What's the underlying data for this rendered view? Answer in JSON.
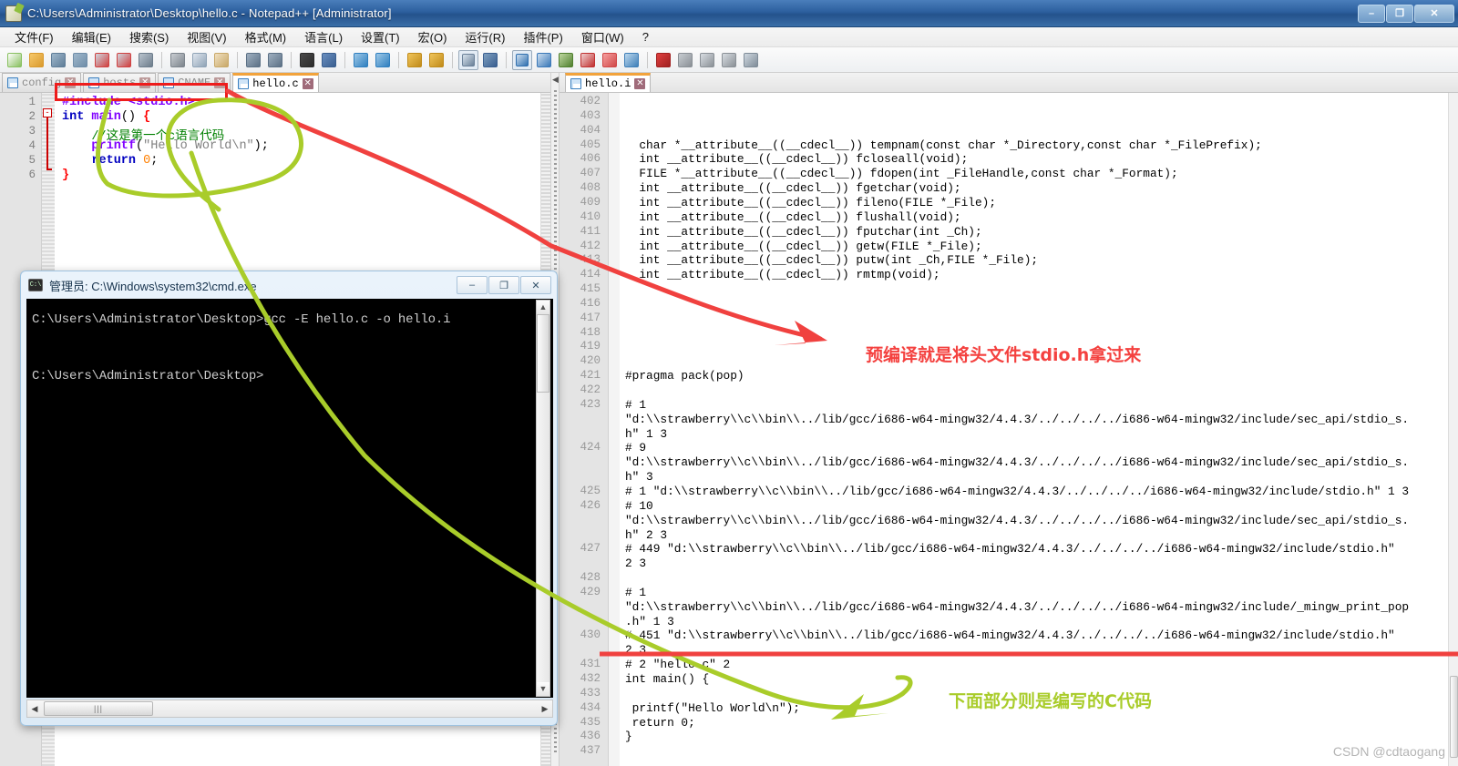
{
  "window": {
    "title": "C:\\Users\\Administrator\\Desktop\\hello.c - Notepad++ [Administrator]",
    "icon": "notepad-plus-plus-icon",
    "minimize": "–",
    "maximize": "❐",
    "close": "✕"
  },
  "menu": {
    "items": [
      "文件(F)",
      "编辑(E)",
      "搜索(S)",
      "视图(V)",
      "格式(M)",
      "语言(L)",
      "设置(T)",
      "宏(O)",
      "运行(R)",
      "插件(P)",
      "窗口(W)",
      "?"
    ]
  },
  "toolbar": {
    "groups": [
      [
        "new-file-icon",
        "open-file-icon",
        "save-icon",
        "save-all-icon",
        "close-file-icon",
        "close-all-icon",
        "print-icon"
      ],
      [
        "cut-icon",
        "copy-icon",
        "paste-icon"
      ],
      [
        "undo-icon",
        "redo-icon"
      ],
      [
        "find-icon",
        "replace-icon"
      ],
      [
        "zoom-in-icon",
        "zoom-out-icon"
      ],
      [
        "sync-scroll-v-icon",
        "sync-scroll-h-icon"
      ],
      [
        "word-wrap-icon",
        "show-all-chars-icon"
      ],
      [
        "indent-guide-icon",
        "user-defined-lang-icon",
        "show-doc-map-icon",
        "function-list-icon",
        "folder-as-workspace-icon",
        "monitor-icon"
      ],
      [
        "macro-record-icon",
        "macro-stop-icon",
        "macro-play-icon",
        "macro-run-multiple-icon",
        "macro-save-icon"
      ]
    ]
  },
  "left_pane": {
    "tabs": [
      {
        "label": "config",
        "active": false
      },
      {
        "label": "hosts",
        "active": false
      },
      {
        "label": "CNAME",
        "active": false
      },
      {
        "label": "hello.c",
        "active": true
      }
    ],
    "lines": [
      {
        "n": "1",
        "tokens": [
          {
            "t": "#include <stdio.h>",
            "c": "pre"
          }
        ]
      },
      {
        "n": "2",
        "tokens": [
          {
            "t": "int",
            "c": "kw"
          },
          {
            "t": " ",
            "c": "pln"
          },
          {
            "t": "main",
            "c": "kw2"
          },
          {
            "t": "()",
            "c": "pln"
          },
          {
            "t": " ",
            "c": "pln"
          },
          {
            "t": "{",
            "c": "brc"
          }
        ]
      },
      {
        "n": "3",
        "tokens": [
          {
            "t": "    //这是第一个c语言代码",
            "c": "cmt"
          }
        ]
      },
      {
        "n": "4",
        "tokens": [
          {
            "t": "    ",
            "c": "pln"
          },
          {
            "t": "printf",
            "c": "kw2"
          },
          {
            "t": "(",
            "c": "pln"
          },
          {
            "t": "\"Hello World\\n\"",
            "c": "str"
          },
          {
            "t": ");",
            "c": "pln"
          }
        ]
      },
      {
        "n": "5",
        "tokens": [
          {
            "t": "    ",
            "c": "pln"
          },
          {
            "t": "return",
            "c": "kw"
          },
          {
            "t": " ",
            "c": "pln"
          },
          {
            "t": "0",
            "c": "num"
          },
          {
            "t": ";",
            "c": "pln"
          }
        ]
      },
      {
        "n": "6",
        "tokens": [
          {
            "t": "}",
            "c": "brc"
          }
        ]
      }
    ]
  },
  "right_pane": {
    "tabs": [
      {
        "label": "hello.i",
        "active": true
      }
    ],
    "lines": [
      {
        "n": "402",
        "text": ""
      },
      {
        "n": "403",
        "text": ""
      },
      {
        "n": "404",
        "text": ""
      },
      {
        "n": "405",
        "text": "  char *__attribute__((__cdecl__)) tempnam(const char *_Directory,const char *_FilePrefix);"
      },
      {
        "n": "406",
        "text": "  int __attribute__((__cdecl__)) fcloseall(void);"
      },
      {
        "n": "407",
        "text": "  FILE *__attribute__((__cdecl__)) fdopen(int _FileHandle,const char *_Format);"
      },
      {
        "n": "408",
        "text": "  int __attribute__((__cdecl__)) fgetchar(void);"
      },
      {
        "n": "409",
        "text": "  int __attribute__((__cdecl__)) fileno(FILE *_File);"
      },
      {
        "n": "410",
        "text": "  int __attribute__((__cdecl__)) flushall(void);"
      },
      {
        "n": "411",
        "text": "  int __attribute__((__cdecl__)) fputchar(int _Ch);"
      },
      {
        "n": "412",
        "text": "  int __attribute__((__cdecl__)) getw(FILE *_File);"
      },
      {
        "n": "413",
        "text": "  int __attribute__((__cdecl__)) putw(int _Ch,FILE *_File);"
      },
      {
        "n": "414",
        "text": "  int __attribute__((__cdecl__)) rmtmp(void);"
      },
      {
        "n": "415",
        "text": ""
      },
      {
        "n": "416",
        "text": ""
      },
      {
        "n": "417",
        "text": ""
      },
      {
        "n": "418",
        "text": ""
      },
      {
        "n": "419",
        "text": ""
      },
      {
        "n": "420",
        "text": ""
      },
      {
        "n": "421",
        "text": "#pragma pack(pop)"
      },
      {
        "n": "422",
        "text": ""
      },
      {
        "n": "423",
        "text": "# 1"
      },
      {
        "n": "",
        "text": "\"d:\\\\strawberry\\\\c\\\\bin\\\\../lib/gcc/i686-w64-mingw32/4.4.3/../../../../i686-w64-mingw32/include/sec_api/stdio_s."
      },
      {
        "n": "",
        "text": "h\" 1 3"
      },
      {
        "n": "424",
        "text": "# 9"
      },
      {
        "n": "",
        "text": "\"d:\\\\strawberry\\\\c\\\\bin\\\\../lib/gcc/i686-w64-mingw32/4.4.3/../../../../i686-w64-mingw32/include/sec_api/stdio_s."
      },
      {
        "n": "",
        "text": "h\" 3"
      },
      {
        "n": "425",
        "text": "# 1 \"d:\\\\strawberry\\\\c\\\\bin\\\\../lib/gcc/i686-w64-mingw32/4.4.3/../../../../i686-w64-mingw32/include/stdio.h\" 1 3"
      },
      {
        "n": "426",
        "text": "# 10"
      },
      {
        "n": "",
        "text": "\"d:\\\\strawberry\\\\c\\\\bin\\\\../lib/gcc/i686-w64-mingw32/4.4.3/../../../../i686-w64-mingw32/include/sec_api/stdio_s."
      },
      {
        "n": "",
        "text": "h\" 2 3"
      },
      {
        "n": "427",
        "text": "# 449 \"d:\\\\strawberry\\\\c\\\\bin\\\\../lib/gcc/i686-w64-mingw32/4.4.3/../../../../i686-w64-mingw32/include/stdio.h\""
      },
      {
        "n": "",
        "text": "2 3"
      },
      {
        "n": "428",
        "text": ""
      },
      {
        "n": "429",
        "text": "# 1"
      },
      {
        "n": "",
        "text": "\"d:\\\\strawberry\\\\c\\\\bin\\\\../lib/gcc/i686-w64-mingw32/4.4.3/../../../../i686-w64-mingw32/include/_mingw_print_pop"
      },
      {
        "n": "",
        "text": ".h\" 1 3"
      },
      {
        "n": "430",
        "text": "# 451 \"d:\\\\strawberry\\\\c\\\\bin\\\\../lib/gcc/i686-w64-mingw32/4.4.3/../../../../i686-w64-mingw32/include/stdio.h\""
      },
      {
        "n": "",
        "text": "2 3"
      },
      {
        "n": "431",
        "text": "# 2 \"hello.c\" 2"
      },
      {
        "n": "432",
        "text": "int main() {"
      },
      {
        "n": "433",
        "text": ""
      },
      {
        "n": "434",
        "text": " printf(\"Hello World\\n\");"
      },
      {
        "n": "435",
        "text": " return 0;"
      },
      {
        "n": "436",
        "text": "}"
      },
      {
        "n": "437",
        "text": ""
      }
    ]
  },
  "cmd_window": {
    "title": "管理员: C:\\Windows\\system32\\cmd.exe",
    "icon": "cmd-icon",
    "minimize": "–",
    "maximize": "❐",
    "close": "✕",
    "lines": [
      "C:\\Users\\Administrator\\Desktop>gcc -E hello.c -o hello.i",
      "",
      "C:\\Users\\Administrator\\Desktop>"
    ],
    "hscroll_grip": "|||",
    "scroll_up": "▲",
    "scroll_down": "▼",
    "scroll_left": "◀",
    "scroll_right": "▶"
  },
  "annotations": {
    "red_note": "预编译就是将头文件stdio.h拿过来",
    "green_note": "下面部分则是编写的C代码",
    "red_color": "#f4413f",
    "green_color": "#a9cc2a"
  },
  "watermark": "CSDN @cdtaogang"
}
